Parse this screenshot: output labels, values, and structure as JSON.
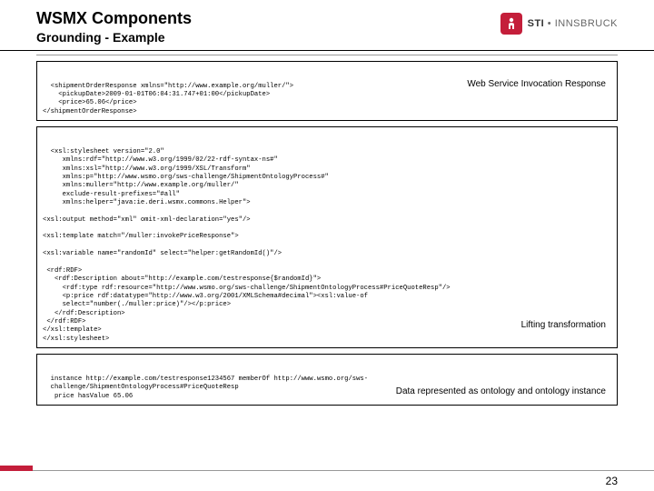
{
  "header": {
    "title": "WSMX Components",
    "subtitle": "Grounding - Example",
    "logo": {
      "brand_sti": "STI",
      "brand_dot": " • ",
      "brand_city": "INNSBRUCK"
    }
  },
  "block1": {
    "annotation": "Web Service Invocation Response",
    "code": "<shipmentOrderResponse xmlns=\"http://www.example.org/muller/\">\n    <pickupDate>2009-01-01T06:04:31.747+01:00</pickupDate>\n    <price>65.06</price>\n</shipmentOrderResponse>"
  },
  "block2": {
    "annotation": "Lifting transformation",
    "code": "<xsl:stylesheet version=\"2.0\"\n     xmlns:rdf=\"http://www.w3.org/1999/02/22-rdf-syntax-ns#\"\n     xmlns:xsl=\"http://www.w3.org/1999/XSL/Transform\"\n     xmlns:p=\"http://www.wsmo.org/sws-challenge/ShipmentOntologyProcess#\"\n     xmlns:muller=\"http://www.example.org/muller/\"\n     exclude-result-prefixes=\"#all\"\n     xmlns:helper=\"java:ie.deri.wsmx.commons.Helper\">\n\n<xsl:output method=\"xml\" omit-xml-declaration=\"yes\"/>\n\n<xsl:template match=\"/muller:invokePriceResponse\">\n\n<xsl:variable name=\"randomId\" select=\"helper:getRandomId()\"/>\n\n <rdf:RDF>\n   <rdf:Description about=\"http://example.com/testresponse{$randomId}\">\n     <rdf:type rdf:resource=\"http://www.wsmo.org/sws-challenge/ShipmentOntologyProcess#PriceQuoteResp\"/>\n     <p:price rdf:datatype=\"http://www.w3.org/2001/XMLSchema#decimal\"><xsl:value-of\n     select=\"number(./muller:price)\"/></p:price>\n   </rdf:Description>\n </rdf:RDF>\n</xsl:template>\n</xsl:stylesheet>"
  },
  "block3": {
    "annotation": "Data represented as ontology and ontology instance",
    "code": "instance http://example.com/testresponse1234567 memberOf http://www.wsmo.org/sws-\n  challenge/ShipmentOntologyProcess#PriceQuoteResp\n   price hasValue 65.06"
  },
  "page": "23"
}
